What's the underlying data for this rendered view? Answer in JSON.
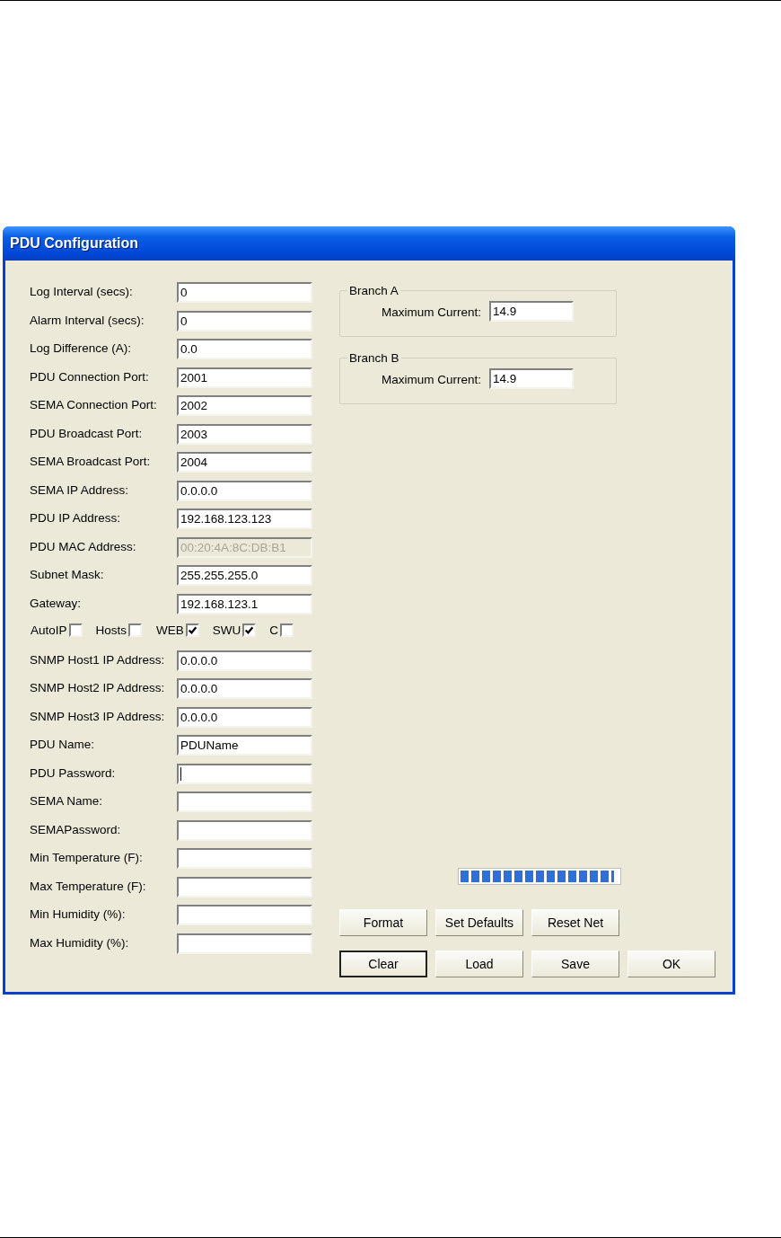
{
  "window": {
    "title": "PDU Configuration"
  },
  "fields_upper": [
    {
      "label": "Log Interval (secs):",
      "value": "0",
      "disabled": false,
      "focused": false
    },
    {
      "label": "Alarm Interval (secs):",
      "value": "0",
      "disabled": false,
      "focused": false
    },
    {
      "label": "Log Difference (A):",
      "value": "0.0",
      "disabled": false,
      "focused": false
    },
    {
      "label": "PDU Connection Port:",
      "value": "2001",
      "disabled": false,
      "focused": false
    },
    {
      "label": "SEMA Connection Port:",
      "value": "2002",
      "disabled": false,
      "focused": false
    },
    {
      "label": "PDU Broadcast Port:",
      "value": "2003",
      "disabled": false,
      "focused": false
    },
    {
      "label": "SEMA Broadcast Port:",
      "value": "2004",
      "disabled": false,
      "focused": false
    },
    {
      "label": "SEMA IP Address:",
      "value": "0.0.0.0",
      "disabled": false,
      "focused": false
    },
    {
      "label": "PDU IP Address:",
      "value": "192.168.123.123",
      "disabled": false,
      "focused": false
    },
    {
      "label": "PDU MAC Address:",
      "value": "00:20:4A:8C:DB:B1",
      "disabled": true,
      "focused": false
    },
    {
      "label": "Subnet Mask:",
      "value": "255.255.255.0",
      "disabled": false,
      "focused": false
    },
    {
      "label": "Gateway:",
      "value": "192.168.123.1",
      "disabled": false,
      "focused": false
    }
  ],
  "options": [
    {
      "label": "AutoIP",
      "checked": false
    },
    {
      "label": "Hosts",
      "checked": false
    },
    {
      "label": "WEB",
      "checked": true
    },
    {
      "label": "SWU",
      "checked": true
    },
    {
      "label": "C",
      "checked": false
    }
  ],
  "fields_lower": [
    {
      "label": "SNMP Host1 IP Address:",
      "value": "0.0.0.0",
      "disabled": false,
      "focused": false
    },
    {
      "label": "SNMP Host2 IP Address:",
      "value": "0.0.0.0",
      "disabled": false,
      "focused": false
    },
    {
      "label": "SNMP Host3 IP Address:",
      "value": "0.0.0.0",
      "disabled": false,
      "focused": false
    },
    {
      "label": "PDU Name:",
      "value": "PDUName",
      "disabled": false,
      "focused": false
    },
    {
      "label": "PDU Password:",
      "disabled": false,
      "focused": true
    },
    {
      "label": "SEMA Name:",
      "disabled": false,
      "focused": false
    },
    {
      "label": "SEMAPassword:",
      "disabled": false,
      "focused": false
    },
    {
      "label": "Min Temperature (F):",
      "disabled": false,
      "focused": false
    },
    {
      "label": "Max Temperature (F):",
      "disabled": false,
      "focused": false
    },
    {
      "label": "Min Humidity (%):",
      "disabled": false,
      "focused": false
    },
    {
      "label": "Max Humidity (%):",
      "disabled": false,
      "focused": false
    }
  ],
  "branches": [
    {
      "title": "Branch A",
      "label": "Maximum Current:",
      "value": "14.9"
    },
    {
      "title": "Branch B",
      "label": "Maximum Current:",
      "value": "14.9"
    }
  ],
  "progress": {
    "level": 0.97
  },
  "button_rows": [
    [
      {
        "label": "Format",
        "default": false
      },
      {
        "label": "Set Defaults",
        "default": false
      },
      {
        "label": "Reset Net",
        "default": false
      }
    ],
    [
      {
        "label": "Clear",
        "default": true
      },
      {
        "label": "Load",
        "default": false
      },
      {
        "label": "Save",
        "default": false
      },
      {
        "label": "OK",
        "default": false
      }
    ]
  ]
}
